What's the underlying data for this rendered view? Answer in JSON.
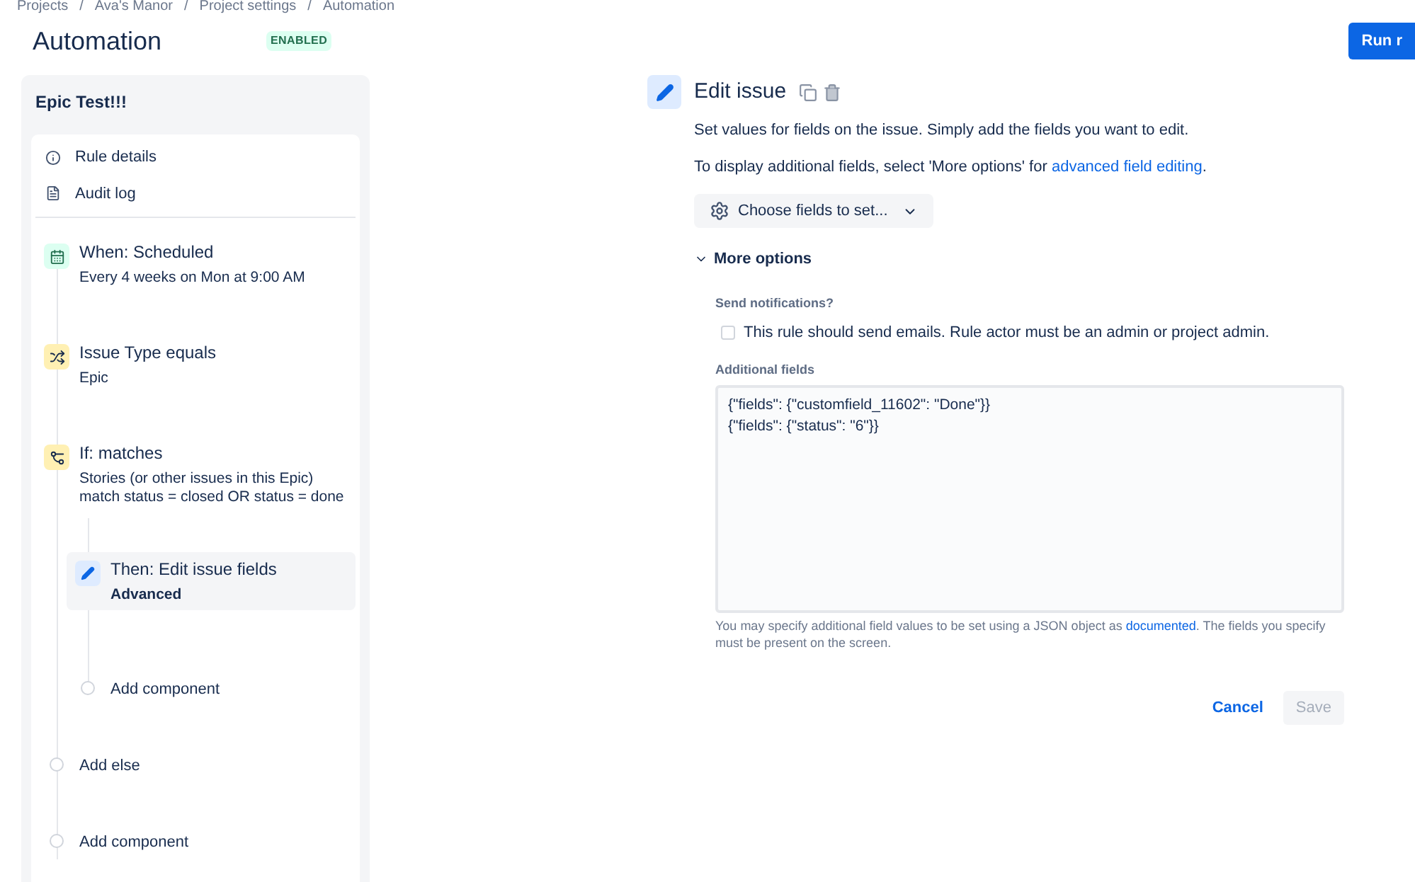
{
  "breadcrumbs": [
    "Projects",
    "Ava's Manor",
    "Project settings",
    "Automation"
  ],
  "breadcrumb_separator": "/",
  "page_title": "Automation",
  "status_badge": "ENABLED",
  "run_button": "Run r",
  "rule": {
    "name": "Epic Test!!!",
    "links": [
      {
        "kind": "info",
        "label": "Rule details"
      },
      {
        "kind": "log",
        "label": "Audit log"
      }
    ],
    "steps": [
      {
        "kind": "trigger",
        "title": "When: Scheduled",
        "detail": "Every 4 weeks on Mon at 9:00 AM",
        "selected": false
      },
      {
        "kind": "condition",
        "title": "Issue Type equals",
        "detail": "Epic",
        "selected": false
      },
      {
        "kind": "branch",
        "title": "If: matches",
        "detail": "Stories (or other issues in this Epic)\nmatch status = closed OR status = done",
        "selected": false,
        "children": [
          {
            "kind": "action",
            "title": "Then: Edit issue fields",
            "detail": "Advanced",
            "selected": true
          },
          {
            "kind": "add",
            "title": "Add component"
          }
        ]
      },
      {
        "kind": "add",
        "title": "Add else"
      },
      {
        "kind": "add",
        "title": "Add component"
      }
    ]
  },
  "editor": {
    "title": "Edit issue",
    "description": "Set values for fields on the issue. Simply add the fields you want to edit.",
    "hint": {
      "text": "To display additional fields, select 'More options' for ",
      "link": "advanced field editing",
      "after": "."
    },
    "choose_button": "Choose fields to set...",
    "more_options": {
      "label": "More options",
      "expanded": true
    },
    "notifications": {
      "label": "Send notifications?",
      "checkbox": "This rule should send emails. Rule actor must be an admin or project admin.",
      "checked": false
    },
    "additional_fields": {
      "label": "Additional fields",
      "value": "{\"fields\": {\"customfield_11602\": \"Done\"}}\n{\"fields\": {\"status\": \"6\"}}",
      "help": "You may specify additional field values to be set using a JSON object as ",
      "help_link": "documented",
      "help_after": ". The fields you specify must be present on the screen."
    },
    "cancel_button": "Cancel",
    "save_button": {
      "label": "Save",
      "disabled": true
    }
  }
}
